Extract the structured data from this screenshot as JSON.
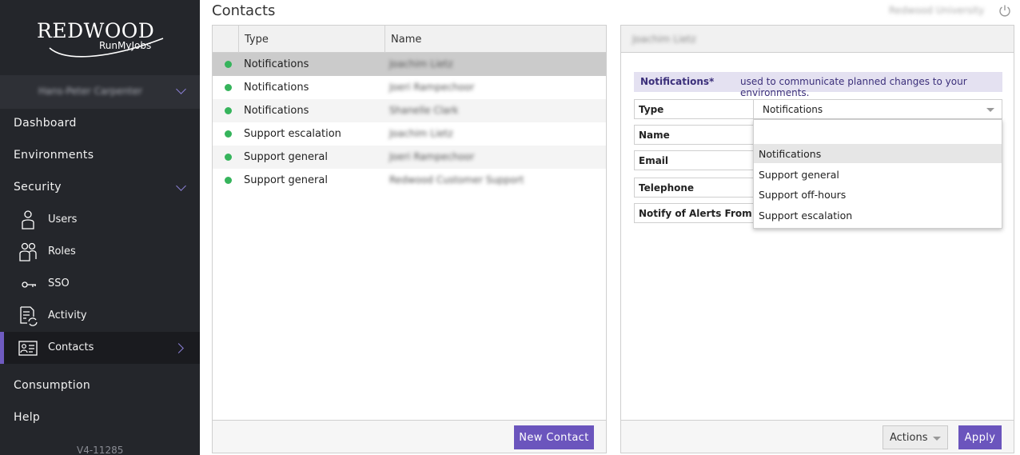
{
  "sidebar": {
    "logo_main": "REDWOOD",
    "logo_sub": "RunMyJobs",
    "user_name": "Hans-Peter Carpenter",
    "nav": {
      "dashboard": "Dashboard",
      "environments": "Environments",
      "security": "Security",
      "consumption": "Consumption",
      "help": "Help"
    },
    "security_items": {
      "users": "Users",
      "roles": "Roles",
      "sso": "SSO",
      "activity": "Activity",
      "contacts": "Contacts"
    },
    "version": "V4-11285"
  },
  "header": {
    "title": "Contacts",
    "org": "Redwood University"
  },
  "contacts_table": {
    "columns": {
      "type": "Type",
      "name": "Name"
    },
    "rows": [
      {
        "type": "Notifications",
        "name": "Joachim Lietz"
      },
      {
        "type": "Notifications",
        "name": "Joeri Rampechoor"
      },
      {
        "type": "Notifications",
        "name": "Shanelle Clark"
      },
      {
        "type": "Support escalation",
        "name": "Joachim Lietz"
      },
      {
        "type": "Support general",
        "name": "Joeri Rampechoor"
      },
      {
        "type": "Support general",
        "name": "Redwood Customer Support"
      }
    ],
    "new_contact_label": "New Contact"
  },
  "detail": {
    "title": "Joachim Lietz",
    "info_bold": "Notifications*",
    "info_text": "used to communicate planned changes to your environments.",
    "fields": {
      "type": "Type",
      "name": "Name",
      "email": "Email",
      "telephone": "Telephone",
      "notify": "Notify of Alerts From"
    },
    "type_value": "Notifications",
    "options": [
      "Notifications",
      "Support general",
      "Support off-hours",
      "Support escalation"
    ],
    "actions_label": "Actions",
    "apply_label": "Apply"
  },
  "colors": {
    "accent": "#6b55bd",
    "sidebar_bg": "#24262b",
    "status_active": "#36b45c"
  }
}
